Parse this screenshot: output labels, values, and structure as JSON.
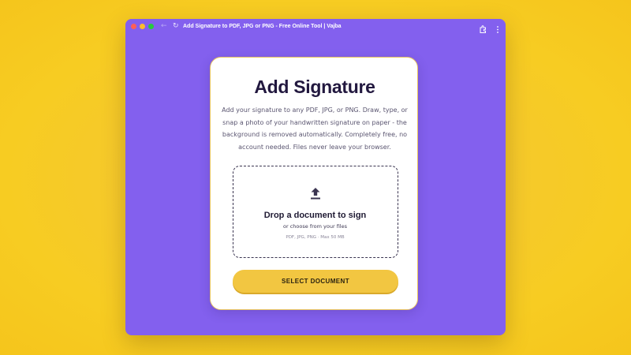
{
  "browser": {
    "tab_title": "Add Signature to PDF, JPG or PNG - Free Online Tool | Vajba",
    "back_icon": "arrow-left-icon",
    "reload_icon": "reload-icon",
    "extensions_icon": "puzzle-icon",
    "menu_icon": "kebab-menu-icon"
  },
  "card": {
    "title": "Add Signature",
    "description": "Add your signature to any PDF, JPG, or PNG. Draw, type, or snap a photo of your handwritten signature on paper - the background is removed automatically. Completely free, no account needed. Files never leave your browser."
  },
  "dropzone": {
    "icon": "upload-icon",
    "title": "Drop a document to sign",
    "subtitle": "or choose from your files",
    "hint": "PDF, JPG, PNG · Max 50 MB"
  },
  "actions": {
    "select_label": "SELECT DOCUMENT"
  },
  "colors": {
    "backdrop": "#f6cb2a",
    "window": "#8360ee",
    "card_border": "#e7c260",
    "button": "#f2c641",
    "title_text": "#22183f"
  }
}
